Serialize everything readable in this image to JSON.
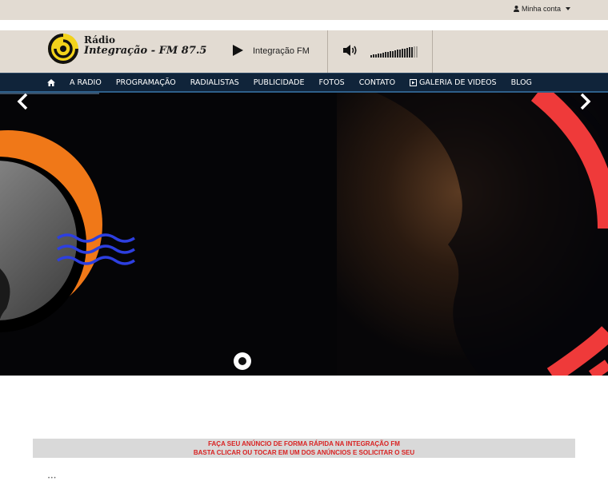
{
  "topbar": {
    "account_label": "Minha conta",
    "account_icon": "user-icon"
  },
  "header": {
    "brand_line1": "Rádio",
    "brand_line2": "Integração - FM 87.5",
    "player_station": "Integração FM",
    "volume_level": 0.9
  },
  "nav": {
    "items": [
      {
        "label": "A RADIO"
      },
      {
        "label": "PROGRAMAÇÃO"
      },
      {
        "label": "RADIALISTAS"
      },
      {
        "label": "PUBLICIDADE"
      },
      {
        "label": "FOTOS"
      },
      {
        "label": "CONTATO"
      },
      {
        "label": "GALERIA DE VIDEOS"
      },
      {
        "label": "BLOG"
      }
    ]
  },
  "slider": {
    "active_slide": 1,
    "slide_count": 1
  },
  "ad": {
    "line1": "FAÇA SEU ANÚNCIO DE FORMA RÁPIDA NA INTEGRAÇÃO FM",
    "line2": "BASTA CLICAR OU TOCAR EM UM DOS ANÚNCIOS E SOLICITAR O SEU"
  },
  "colors": {
    "nav_bg": "#10243a",
    "header_bg": "#e2dbd2",
    "accent_orange": "#f07818",
    "accent_red": "#ef3a3a",
    "ad_text": "#d92222"
  }
}
